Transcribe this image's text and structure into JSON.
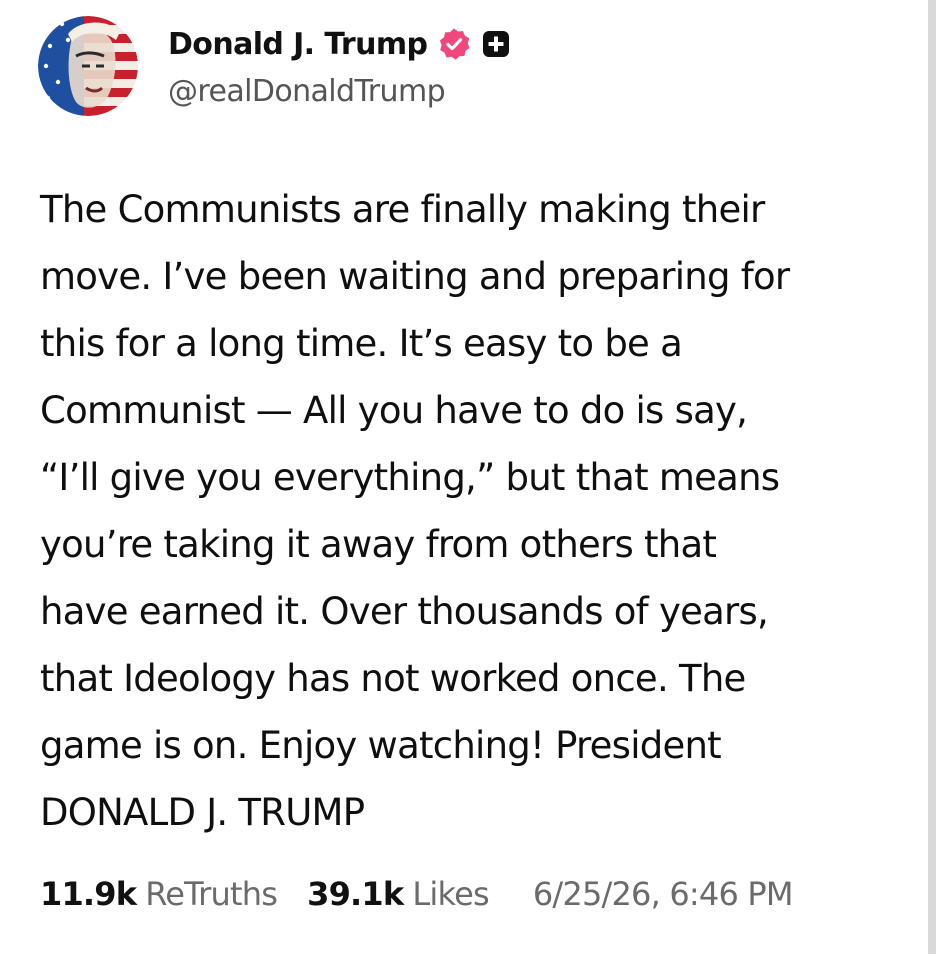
{
  "author": {
    "display_name": "Donald J. Trump",
    "handle": "@realDonaldTrump",
    "verified_badge_icon": "verified-check-badge-icon",
    "verified_badge_color": "#f0487c",
    "plus_badge_icon": "plus-square-icon",
    "avatar": "flag-portrait-avatar"
  },
  "post": {
    "lines": [
      "The Communists are finally making their",
      "move. I’ve been waiting and preparing for",
      "this for a long time. It’s easy to be a",
      "Communist — All you have to do is say,",
      "“I’ll give you everything,” but that means",
      "you’re taking it away from others that",
      "have earned it. Over thousands of years,",
      "that Ideology has not worked once. The",
      "game is on. Enjoy watching! President",
      "DONALD J. TRUMP"
    ]
  },
  "stats": {
    "retruths_count": "11.9k",
    "retruths_label": "ReTruths",
    "likes_count": "39.1k",
    "likes_label": "Likes",
    "timestamp": "6/25/26, 6:46 PM"
  }
}
